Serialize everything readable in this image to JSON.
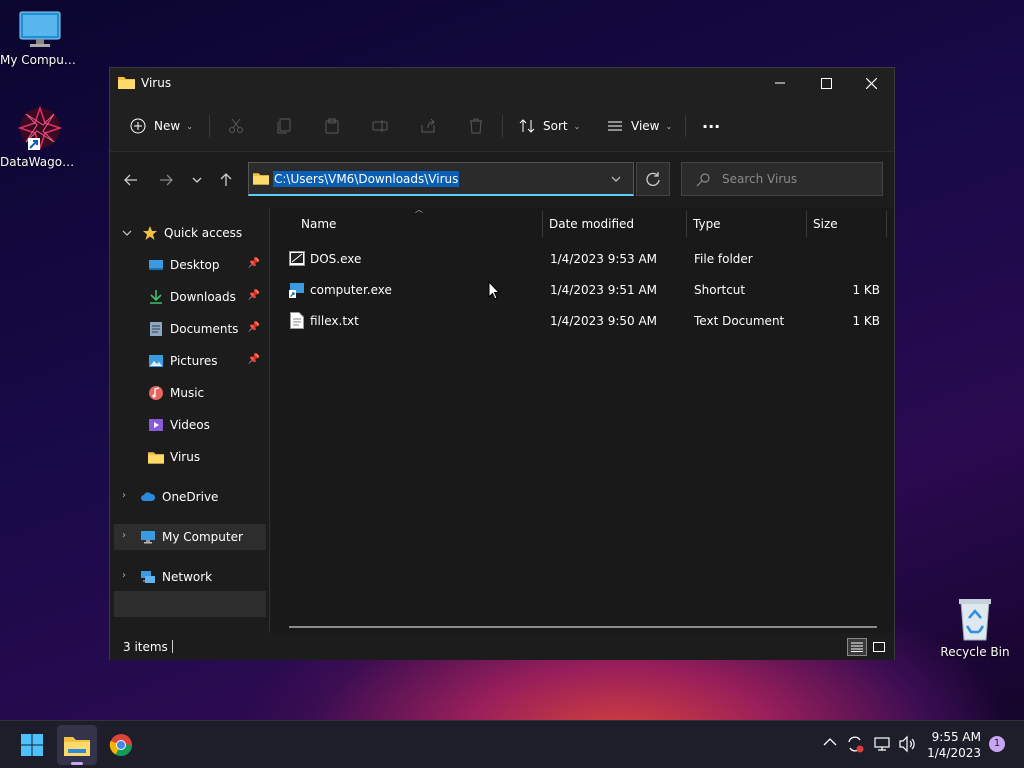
{
  "desktop": {
    "icons": [
      {
        "label": "My Computer"
      },
      {
        "label": "DataWagon..."
      },
      {
        "label": "Recycle Bin"
      }
    ]
  },
  "window": {
    "title": "Virus",
    "controls": {
      "minimize": "—",
      "maximize": "☐",
      "close": "✕"
    }
  },
  "commandbar": {
    "new_label": "New",
    "sort_label": "Sort",
    "view_label": "View",
    "more_label": "···"
  },
  "navigation": {
    "address_path": "C:\\Users\\VM6\\Downloads\\Virus",
    "search_placeholder": "Search Virus"
  },
  "sidebar": {
    "quick_access": "Quick access",
    "items": [
      {
        "label": "Desktop",
        "pinned": true
      },
      {
        "label": "Downloads",
        "pinned": true
      },
      {
        "label": "Documents",
        "pinned": true
      },
      {
        "label": "Pictures",
        "pinned": true
      },
      {
        "label": "Music",
        "pinned": false
      },
      {
        "label": "Videos",
        "pinned": false
      },
      {
        "label": "Virus",
        "pinned": false
      }
    ],
    "onedrive": "OneDrive",
    "my_computer": "My Computer",
    "network": "Network"
  },
  "filelist": {
    "columns": [
      "Name",
      "Date modified",
      "Type",
      "Size"
    ],
    "rows": [
      {
        "name": "DOS.exe",
        "date": "1/4/2023 9:53 AM",
        "type": "File folder",
        "size": ""
      },
      {
        "name": "computer.exe",
        "date": "1/4/2023 9:51 AM",
        "type": "Shortcut",
        "size": "1 KB"
      },
      {
        "name": "fillex.txt",
        "date": "1/4/2023 9:50 AM",
        "type": "Text Document",
        "size": "1 KB"
      }
    ]
  },
  "statusbar": {
    "item_count": "3 items"
  },
  "taskbar": {
    "time": "9:55 AM",
    "date": "1/4/2023",
    "notification_count": "1"
  },
  "colors": {
    "accent": "#60cdff",
    "selection": "#0a5fb4",
    "folder": "#f3c047"
  }
}
